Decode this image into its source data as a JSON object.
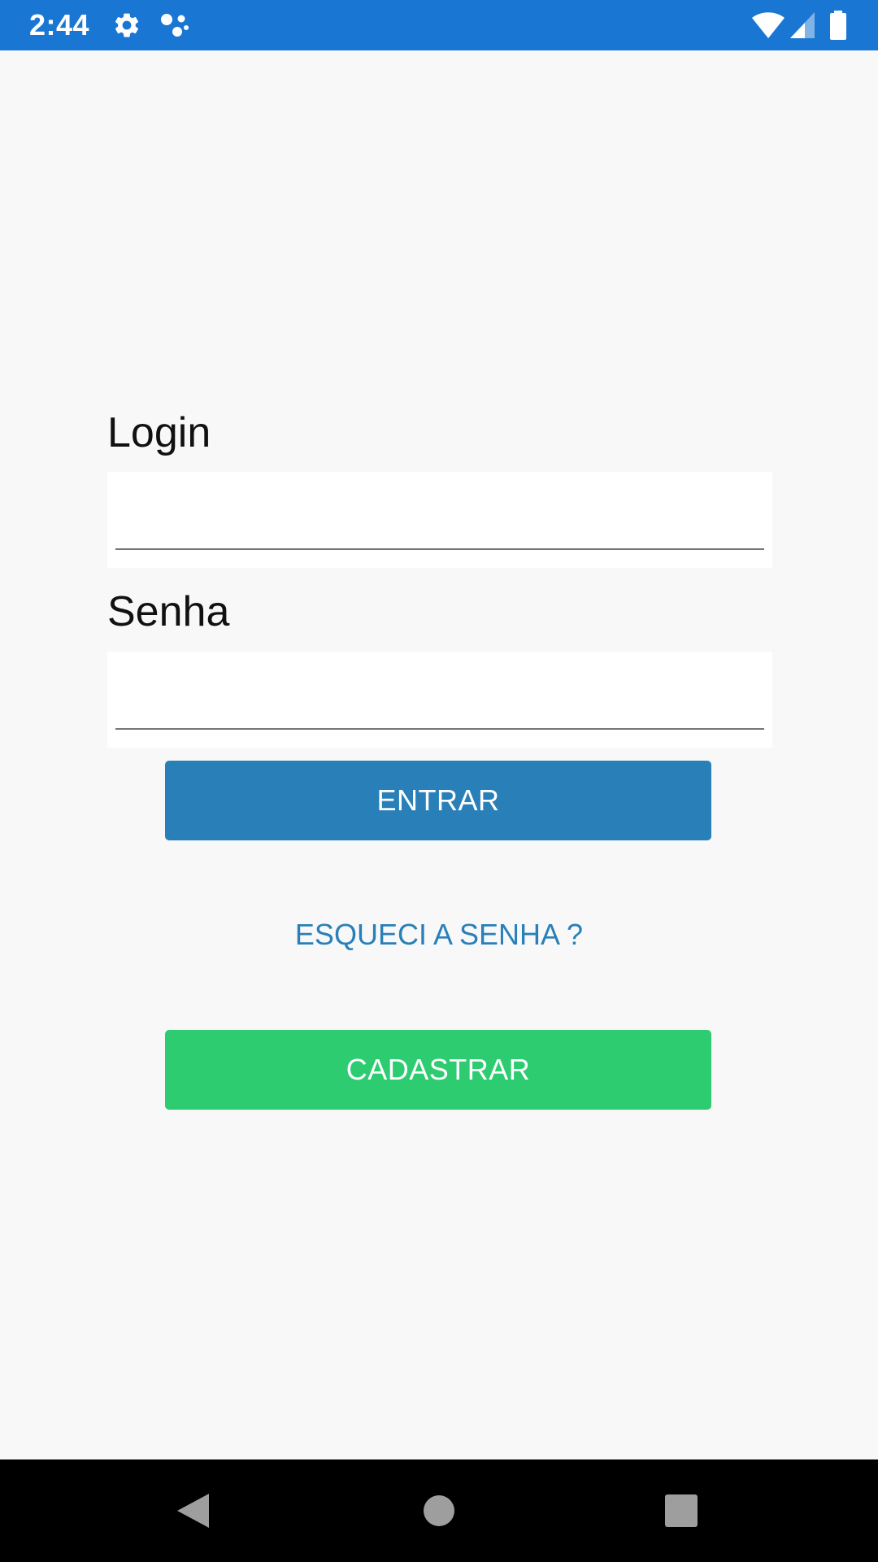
{
  "status_bar": {
    "time": "2:44",
    "icons": [
      "gear-icon",
      "assistant-dots-icon",
      "wifi-icon",
      "signal-icon",
      "battery-icon"
    ],
    "color": "#1976d2"
  },
  "form": {
    "login_label": "Login",
    "login_value": "",
    "password_label": "Senha",
    "password_value": ""
  },
  "actions": {
    "enter_label": "ENTRAR",
    "enter_color": "#2980b9",
    "forgot_label": "ESQUECI A SENHA ?",
    "register_label": "CADASTRAR",
    "register_color": "#2ecc71"
  },
  "nav_bar": {
    "buttons": [
      "back-icon",
      "home-icon",
      "recents-icon"
    ]
  }
}
